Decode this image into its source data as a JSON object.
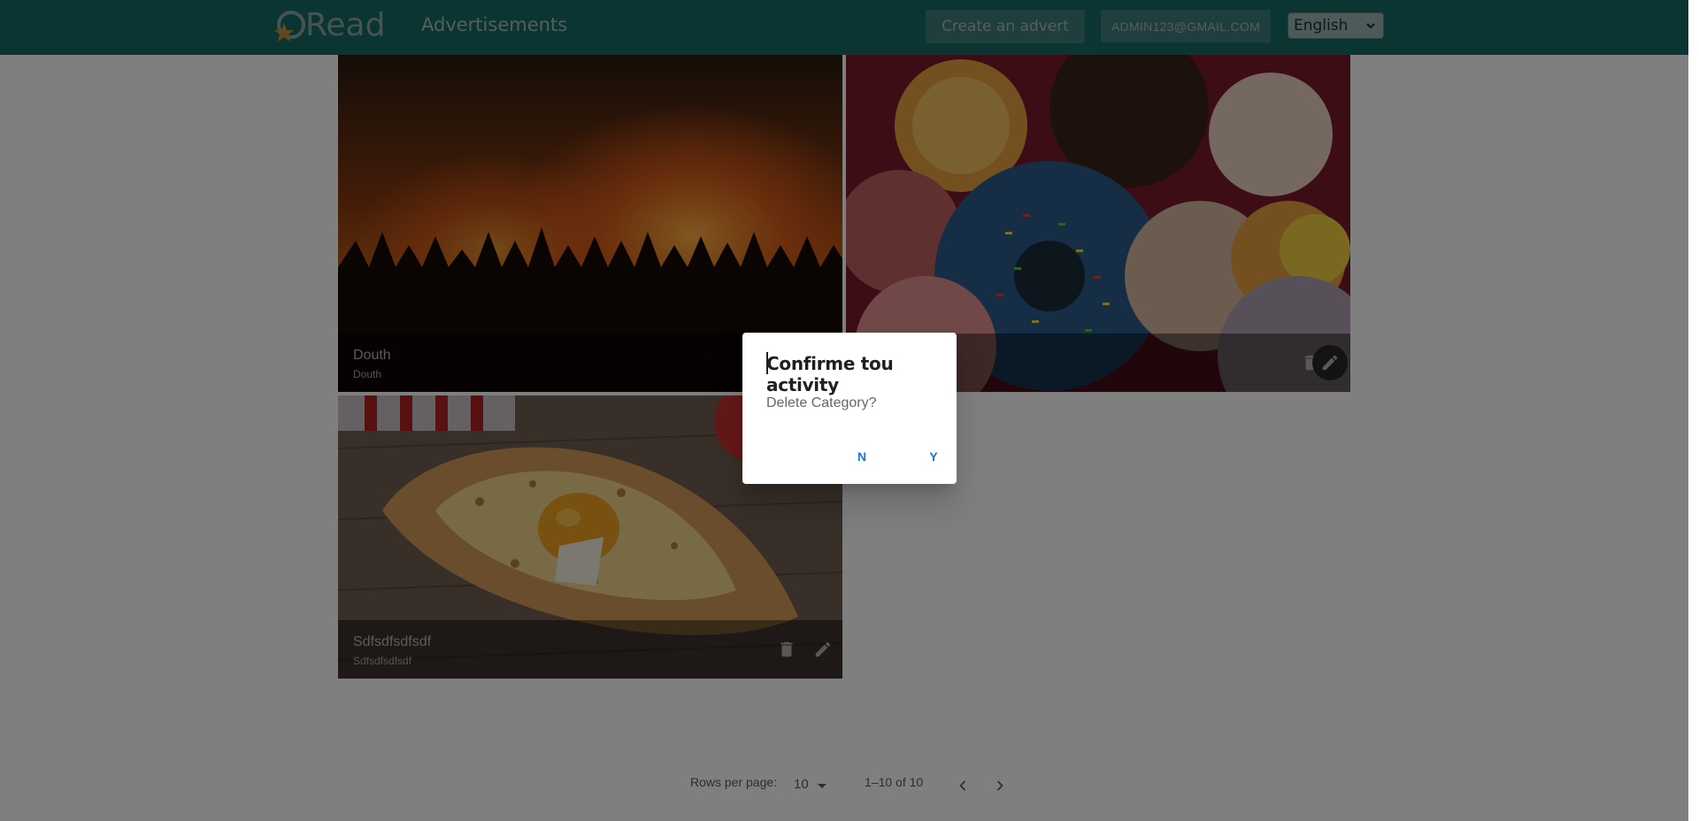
{
  "header": {
    "logo_text": "Read",
    "nav_title": "Advertisements",
    "create_label": "Create an advert",
    "account_label": "ADMIN123@GMAIL.COM",
    "language": "English"
  },
  "cards": [
    {
      "title": "Douth",
      "subtitle": "Douth",
      "image": "forest-fire-photo"
    },
    {
      "title": "",
      "subtitle": "",
      "image": "donuts-photo"
    },
    {
      "title": "Sdfsdfsdfsdf",
      "subtitle": "Sdfsdfsdfsdf",
      "image": "khachapuri-photo"
    }
  ],
  "dialog": {
    "title": "Confirme tou activity",
    "body": "Delete Category?",
    "no_label": "N",
    "yes_label": "Y"
  },
  "pagination": {
    "rows_label": "Rows per page:",
    "rows_value": "10",
    "range": "1–10 of 10"
  },
  "colors": {
    "header_bg": "#156b66",
    "dialog_action": "#1976d2"
  }
}
